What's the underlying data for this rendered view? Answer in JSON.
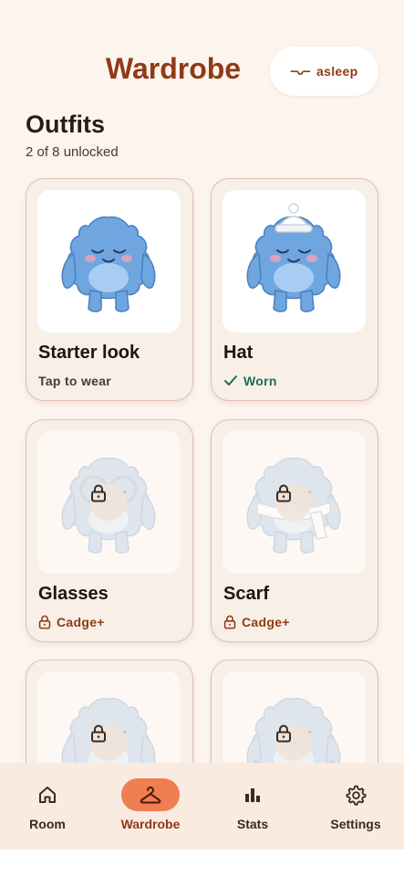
{
  "header": {
    "title": "Wardrobe",
    "status_face": "—ᴗ—",
    "status_label": "asleep"
  },
  "section": {
    "title": "Outfits",
    "progress": "2 of 8 unlocked"
  },
  "outfits": [
    {
      "name": "Starter look",
      "status": "Tap to wear",
      "state": "available",
      "accessory": "none"
    },
    {
      "name": "Hat",
      "status": "Worn",
      "state": "worn",
      "accessory": "hat"
    },
    {
      "name": "Glasses",
      "status": "Cadge+",
      "state": "locked",
      "accessory": "glasses"
    },
    {
      "name": "Scarf",
      "status": "Cadge+",
      "state": "locked",
      "accessory": "scarf"
    },
    {
      "name": "",
      "status": "",
      "state": "locked",
      "accessory": "none"
    },
    {
      "name": "",
      "status": "",
      "state": "locked",
      "accessory": "collar"
    }
  ],
  "nav": {
    "items": [
      {
        "label": "Room",
        "icon": "home-icon"
      },
      {
        "label": "Wardrobe",
        "icon": "hanger-icon",
        "active": true
      },
      {
        "label": "Stats",
        "icon": "bar-chart-icon"
      },
      {
        "label": "Settings",
        "icon": "gear-icon"
      }
    ]
  },
  "colors": {
    "background": "#fdf4ee",
    "accent": "#8f3a17",
    "active_nav": "#f07e52",
    "worn": "#1d6b5d",
    "monster_blue": "#6fa6e0"
  }
}
